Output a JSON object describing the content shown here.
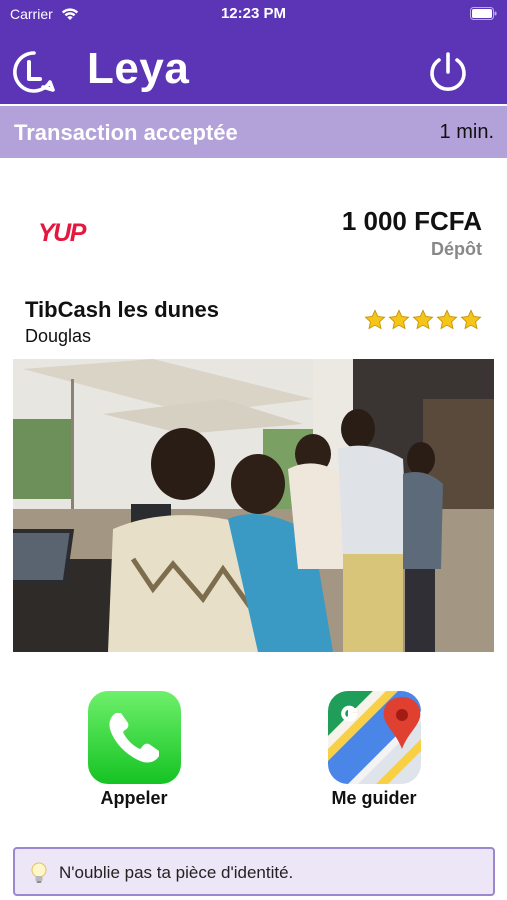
{
  "status_bar": {
    "carrier": "Carrier",
    "time": "12:23 PM"
  },
  "header": {
    "title": "Leya",
    "logo_icon": "leya-logo-icon",
    "power_icon": "power-icon",
    "background": "#5b35b6"
  },
  "status": {
    "text": "Transaction acceptée",
    "elapsed": "1 min.",
    "background": "#b3a1d9"
  },
  "transaction": {
    "partner_logo_text": "YUP",
    "amount": "1 000 FCFA",
    "type": "Dépôt"
  },
  "agent": {
    "name": "TibCash les dunes",
    "contact": "Douglas",
    "rating": 5,
    "rating_max": 5
  },
  "actions": {
    "call_label": "Appeler",
    "call_icon": "phone-icon",
    "guide_label": "Me guider",
    "guide_icon": "google-maps-icon"
  },
  "tip": {
    "icon": "lightbulb-icon",
    "text": "N'oublie pas ta pièce d'identité."
  }
}
